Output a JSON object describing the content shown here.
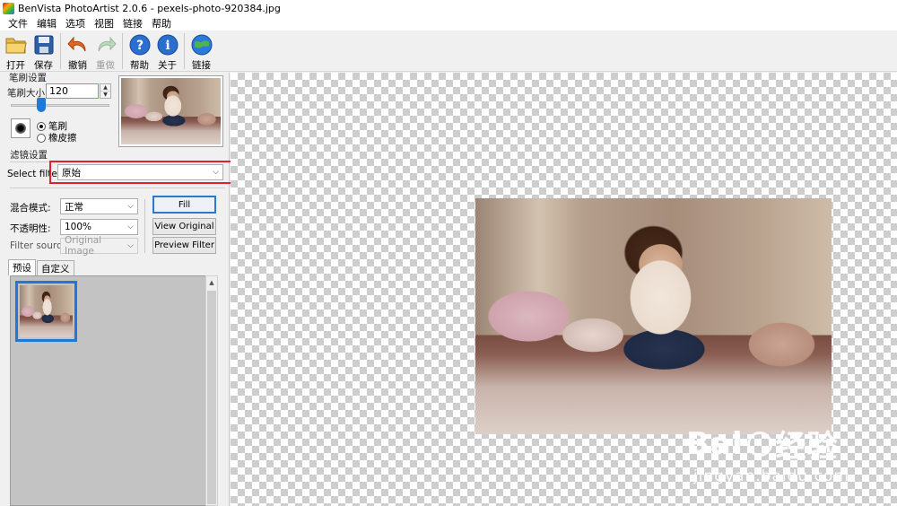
{
  "window": {
    "title": "BenVista PhotoArtist 2.0.6 - pexels-photo-920384.jpg"
  },
  "menu": [
    "文件",
    "编辑",
    "选项",
    "视图",
    "链接",
    "帮助"
  ],
  "toolbar": {
    "open": "打开",
    "save": "保存",
    "undo": "撤销",
    "redo": "重做",
    "help": "帮助",
    "about": "关于",
    "link": "链接"
  },
  "brush_settings": {
    "group_title": "笔刷设置",
    "size_label": "笔刷大小:",
    "size_value": "120",
    "size_slider_fraction": 0.28,
    "mode_brush": "笔刷",
    "mode_eraser": "橡皮擦",
    "selected_mode": "笔刷"
  },
  "filter_settings": {
    "group_title": "滤镜设置",
    "select_filter_label": "Select filter:",
    "select_filter_value": "原始",
    "blend_mode_label": "混合模式:",
    "blend_mode_value": "正常",
    "opacity_label": "不透明性:",
    "opacity_value": "100%",
    "filter_source_label": "Filter source:",
    "filter_source_value": "Original Image",
    "fill_button": "Fill",
    "view_original_button": "View Original",
    "preview_filter_button": "Preview Filter"
  },
  "tabs": [
    "预设",
    "自定义"
  ],
  "active_tab": "预设",
  "watermark": {
    "brand_left": "Bai",
    "brand_right": "经验",
    "url": "jingyan.baidu.com"
  },
  "colors": {
    "highlight": "#e0202a",
    "accent": "#1e78d7"
  }
}
